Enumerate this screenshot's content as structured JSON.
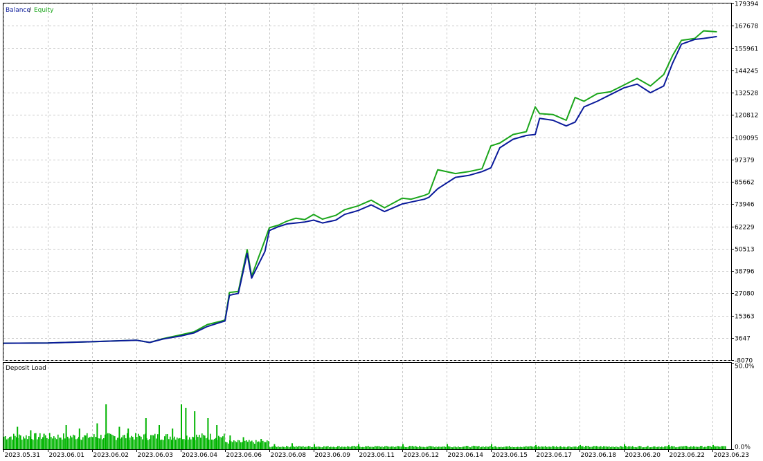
{
  "colors": {
    "balance": "#0a1a9a",
    "equity": "#1aa51a",
    "grid": "#c8c8c8",
    "axis": "#000000",
    "load": "#00b400"
  },
  "legend": {
    "balance": "Balance",
    "separator": "/",
    "equity": "Equity"
  },
  "sub_panel": {
    "title": "Deposit Load"
  },
  "chart_data": [
    {
      "type": "line",
      "title": "",
      "legend_placement": "top-left",
      "grid": true,
      "y_ticks": [
        "179394",
        "167678",
        "155961",
        "144245",
        "132528",
        "120812",
        "109095",
        "97379",
        "85662",
        "73946",
        "62229",
        "50513",
        "38796",
        "27080",
        "15363",
        "3647",
        "-8070"
      ],
      "x_ticks": [
        "2023.05.31",
        "2023.06.01",
        "2023.06.02",
        "2023.06.03",
        "2023.06.04",
        "2023.06.06",
        "2023.06.08",
        "2023.06.09",
        "2023.06.11",
        "2023.06.12",
        "2023.06.14",
        "2023.06.15",
        "2023.06.17",
        "2023.06.18",
        "2023.06.20",
        "2023.06.22",
        "2023.06.23"
      ],
      "ylim": [
        -8070,
        179394
      ],
      "xlim": [
        0,
        16.3
      ],
      "series": [
        {
          "name": "Balance",
          "points": [
            [
              0,
              800
            ],
            [
              1,
              900
            ],
            [
              2,
              1600
            ],
            [
              3,
              2400
            ],
            [
              3.3,
              1200
            ],
            [
              3.6,
              3000
            ],
            [
              4,
              4600
            ],
            [
              4.3,
              6200
            ],
            [
              4.6,
              9600
            ],
            [
              4.9,
              11800
            ],
            [
              5,
              12500
            ],
            [
              5.1,
              26000
            ],
            [
              5.3,
              27000
            ],
            [
              5.5,
              48000
            ],
            [
              5.6,
              35000
            ],
            [
              5.9,
              49000
            ],
            [
              6,
              60000
            ],
            [
              6.2,
              62000
            ],
            [
              6.4,
              63500
            ],
            [
              6.6,
              64000
            ],
            [
              6.8,
              64500
            ],
            [
              7,
              65500
            ],
            [
              7.2,
              64000
            ],
            [
              7.5,
              65500
            ],
            [
              7.7,
              68500
            ],
            [
              8,
              70500
            ],
            [
              8.3,
              73500
            ],
            [
              8.6,
              70000
            ],
            [
              9,
              74000
            ],
            [
              9.2,
              75000
            ],
            [
              9.5,
              76500
            ],
            [
              9.6,
              77500
            ],
            [
              9.8,
              82000
            ],
            [
              10.2,
              88000
            ],
            [
              10.5,
              89000
            ],
            [
              10.8,
              91000
            ],
            [
              11,
              93000
            ],
            [
              11.2,
              103500
            ],
            [
              11.5,
              108000
            ],
            [
              11.8,
              110000
            ],
            [
              12,
              110500
            ],
            [
              12.1,
              119000
            ],
            [
              12.4,
              118000
            ],
            [
              12.7,
              115000
            ],
            [
              12.9,
              117000
            ],
            [
              13.1,
              125000
            ],
            [
              13.4,
              128000
            ],
            [
              13.7,
              131500
            ],
            [
              14,
              135000
            ],
            [
              14.3,
              137000
            ],
            [
              14.6,
              132500
            ],
            [
              14.9,
              136000
            ],
            [
              15.1,
              148000
            ],
            [
              15.3,
              158000
            ],
            [
              15.6,
              160500
            ],
            [
              15.8,
              161000
            ],
            [
              16.1,
              162000
            ]
          ]
        },
        {
          "name": "Equity",
          "points": [
            [
              0,
              800
            ],
            [
              1,
              900
            ],
            [
              2,
              1600
            ],
            [
              3,
              2400
            ],
            [
              3.3,
              1200
            ],
            [
              3.6,
              3200
            ],
            [
              4,
              5200
            ],
            [
              4.3,
              6800
            ],
            [
              4.6,
              10600
            ],
            [
              4.9,
              12300
            ],
            [
              5,
              13000
            ],
            [
              5.1,
              27500
            ],
            [
              5.3,
              28000
            ],
            [
              5.5,
              50000
            ],
            [
              5.6,
              36000
            ],
            [
              5.9,
              55000
            ],
            [
              6,
              61500
            ],
            [
              6.2,
              62800
            ],
            [
              6.4,
              65000
            ],
            [
              6.6,
              66500
            ],
            [
              6.8,
              65800
            ],
            [
              7,
              68500
            ],
            [
              7.2,
              66000
            ],
            [
              7.5,
              68000
            ],
            [
              7.7,
              71000
            ],
            [
              8,
              73000
            ],
            [
              8.3,
              76000
            ],
            [
              8.6,
              72000
            ],
            [
              9,
              77000
            ],
            [
              9.2,
              76500
            ],
            [
              9.5,
              78500
            ],
            [
              9.6,
              79500
            ],
            [
              9.8,
              92000
            ],
            [
              10.2,
              90000
            ],
            [
              10.5,
              91000
            ],
            [
              10.8,
              92500
            ],
            [
              11,
              104500
            ],
            [
              11.2,
              106000
            ],
            [
              11.5,
              110500
            ],
            [
              11.8,
              112000
            ],
            [
              12,
              125000
            ],
            [
              12.1,
              121500
            ],
            [
              12.4,
              121000
            ],
            [
              12.7,
              118000
            ],
            [
              12.9,
              130000
            ],
            [
              13.1,
              128000
            ],
            [
              13.4,
              132000
            ],
            [
              13.7,
              133000
            ],
            [
              14,
              136500
            ],
            [
              14.3,
              140000
            ],
            [
              14.6,
              136000
            ],
            [
              14.9,
              142000
            ],
            [
              15.1,
              152000
            ],
            [
              15.3,
              160000
            ],
            [
              15.6,
              161000
            ],
            [
              15.8,
              165000
            ],
            [
              16.1,
              164500
            ]
          ]
        }
      ]
    },
    {
      "type": "bar",
      "title": "Deposit Load",
      "unit": "%",
      "y_ticks": [
        "50.0%",
        "0.0%"
      ],
      "ylim": [
        0,
        50
      ],
      "series": [
        {
          "name": "Deposit Load",
          "segments": [
            {
              "x_start": 0,
              "x_end": 1,
              "base": 7,
              "spikes": [
                [
                  0.3,
                  13
                ],
                [
                  0.6,
                  11
                ],
                [
                  0.9,
                  9
                ]
              ]
            },
            {
              "x_start": 1,
              "x_end": 2,
              "base": 7,
              "spikes": [
                [
                  1.4,
                  14
                ],
                [
                  1.7,
                  12
                ]
              ]
            },
            {
              "x_start": 2,
              "x_end": 3,
              "base": 7,
              "spikes": [
                [
                  2.3,
                  26
                ],
                [
                  2.1,
                  15
                ],
                [
                  2.6,
                  13
                ],
                [
                  2.8,
                  12
                ]
              ]
            },
            {
              "x_start": 3,
              "x_end": 4,
              "base": 7,
              "spikes": [
                [
                  3.2,
                  18
                ],
                [
                  3.5,
                  14
                ],
                [
                  3.8,
                  12
                ]
              ]
            },
            {
              "x_start": 4,
              "x_end": 5,
              "base": 7,
              "spikes": [
                [
                  4.0,
                  26
                ],
                [
                  4.1,
                  24
                ],
                [
                  4.3,
                  22
                ],
                [
                  4.6,
                  18
                ],
                [
                  4.8,
                  14
                ]
              ]
            },
            {
              "x_start": 5,
              "x_end": 6,
              "base": 4,
              "spikes": [
                [
                  5.1,
                  8
                ],
                [
                  5.4,
                  7
                ],
                [
                  5.8,
                  6
                ]
              ]
            },
            {
              "x_start": 6,
              "x_end": 16.3,
              "base": 1.5,
              "spikes": [
                [
                  6.1,
                  3
                ],
                [
                  6.5,
                  3.5
                ],
                [
                  7,
                  3
                ],
                [
                  8,
                  3
                ],
                [
                  9,
                  3
                ],
                [
                  10,
                  3
                ],
                [
                  11,
                  3
                ],
                [
                  12,
                  2.5
                ],
                [
                  13,
                  2.5
                ],
                [
                  14,
                  3
                ],
                [
                  15,
                  2.5
                ],
                [
                  16,
                  2.5
                ]
              ]
            }
          ]
        }
      ]
    }
  ]
}
